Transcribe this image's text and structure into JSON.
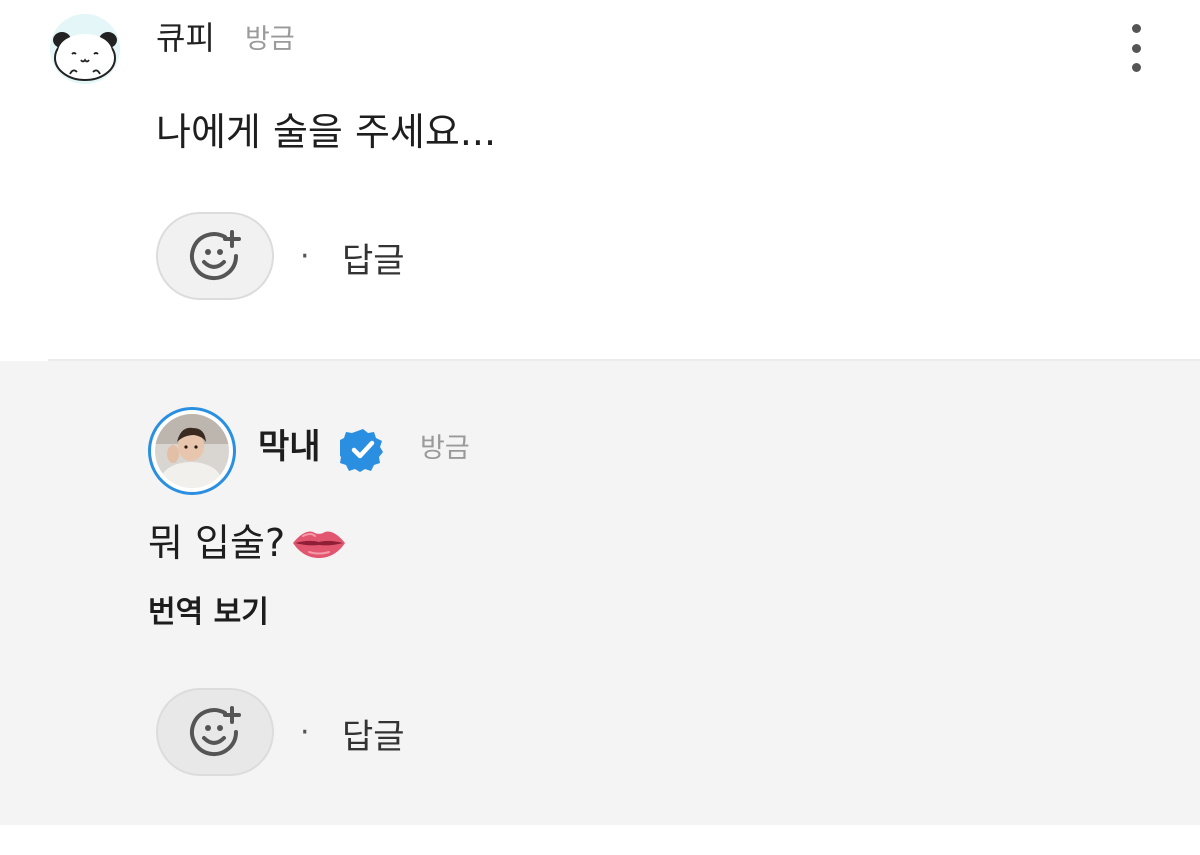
{
  "comment": {
    "author": "큐피",
    "time": "방금",
    "text": "나에게 술을 주세요...",
    "reply_label": "답글",
    "separator": "·"
  },
  "reply": {
    "author": "막내",
    "time": "방금",
    "text": "뭐 입술?",
    "translate_label": "번역 보기",
    "reply_label": "답글",
    "separator": "·"
  },
  "icons": {
    "more": "more-vertical-icon",
    "reaction": "smiley-plus-icon",
    "verified": "verified-badge-icon",
    "lips": "lips-emoji"
  },
  "colors": {
    "verified_blue": "#2a8fe0",
    "reply_background": "#f4f4f5",
    "muted_text": "#9a9a9a"
  }
}
